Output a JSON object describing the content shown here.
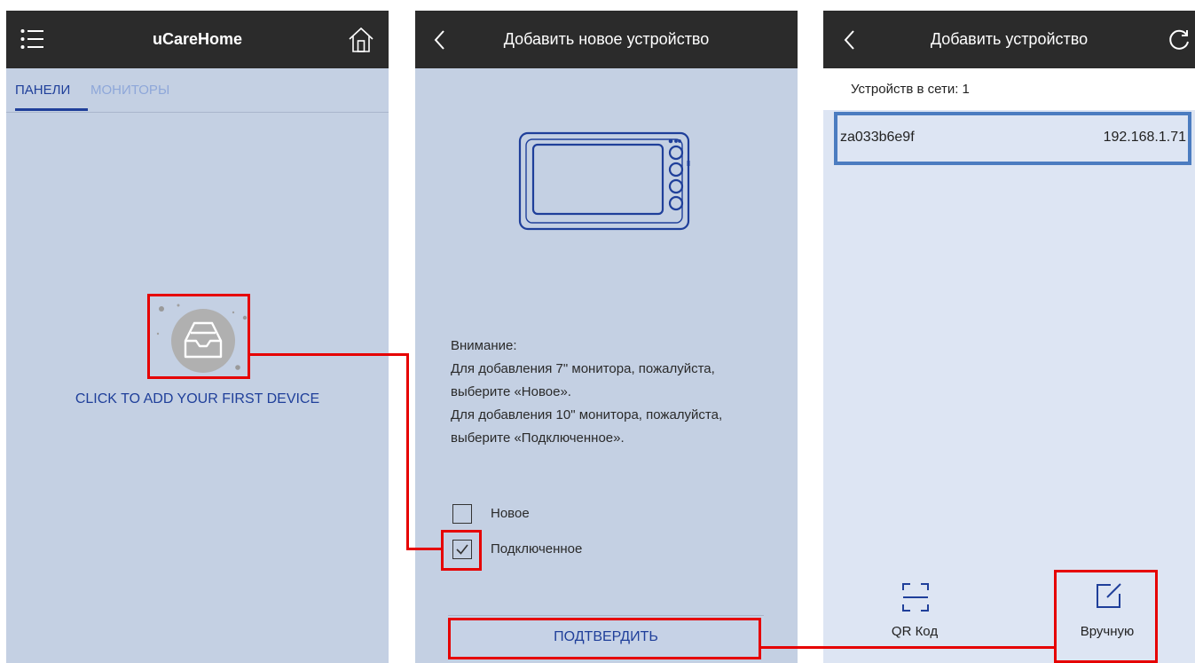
{
  "screen1": {
    "title": "uCareHome",
    "tabs": [
      {
        "label": "ПАНЕЛИ",
        "active": true
      },
      {
        "label": "МОНИТОРЫ",
        "active": false
      }
    ],
    "add_device_label": "CLICK TO ADD YOUR FIRST DEVICE",
    "icons": {
      "menu": "menu-list-icon",
      "home": "home-icon",
      "add": "empty-inbox-icon"
    }
  },
  "screen2": {
    "title": "Добавить новое устройство",
    "notice_lines": [
      "Внимание:",
      "Для добавления 7\" монитора, пожалуйста,",
      "выберите «Новое».",
      "Для добавления 10\" монитора, пожалуйста,",
      "выберите «Подключенное»."
    ],
    "options": [
      {
        "label": "Новое",
        "checked": false
      },
      {
        "label": "Подключенное",
        "checked": true
      }
    ],
    "confirm_label": "ПОДТВЕРДИТЬ",
    "icons": {
      "back": "back-chevron-icon",
      "device": "intercom-monitor-icon"
    }
  },
  "screen3": {
    "title": "Добавить устройство",
    "devices_count_label": "Устройств в сети: 1",
    "devices": [
      {
        "name": "za033b6e9f",
        "ip": "192.168.1.71"
      }
    ],
    "bottom_actions": [
      {
        "label": "QR Код",
        "icon": "qr-scan-icon"
      },
      {
        "label": "Вручную",
        "icon": "edit-icon"
      }
    ],
    "icons": {
      "back": "back-chevron-icon",
      "refresh": "refresh-icon"
    }
  },
  "colors": {
    "topbar": "#2b2b2b",
    "screen_bg": "#c4d0e3",
    "screen3_bg": "#dde5f3",
    "accent": "#1f3f9a",
    "inactive_tab": "#8ea7d9",
    "highlight": "#e60000",
    "selected_row": "#4b7cc0"
  }
}
